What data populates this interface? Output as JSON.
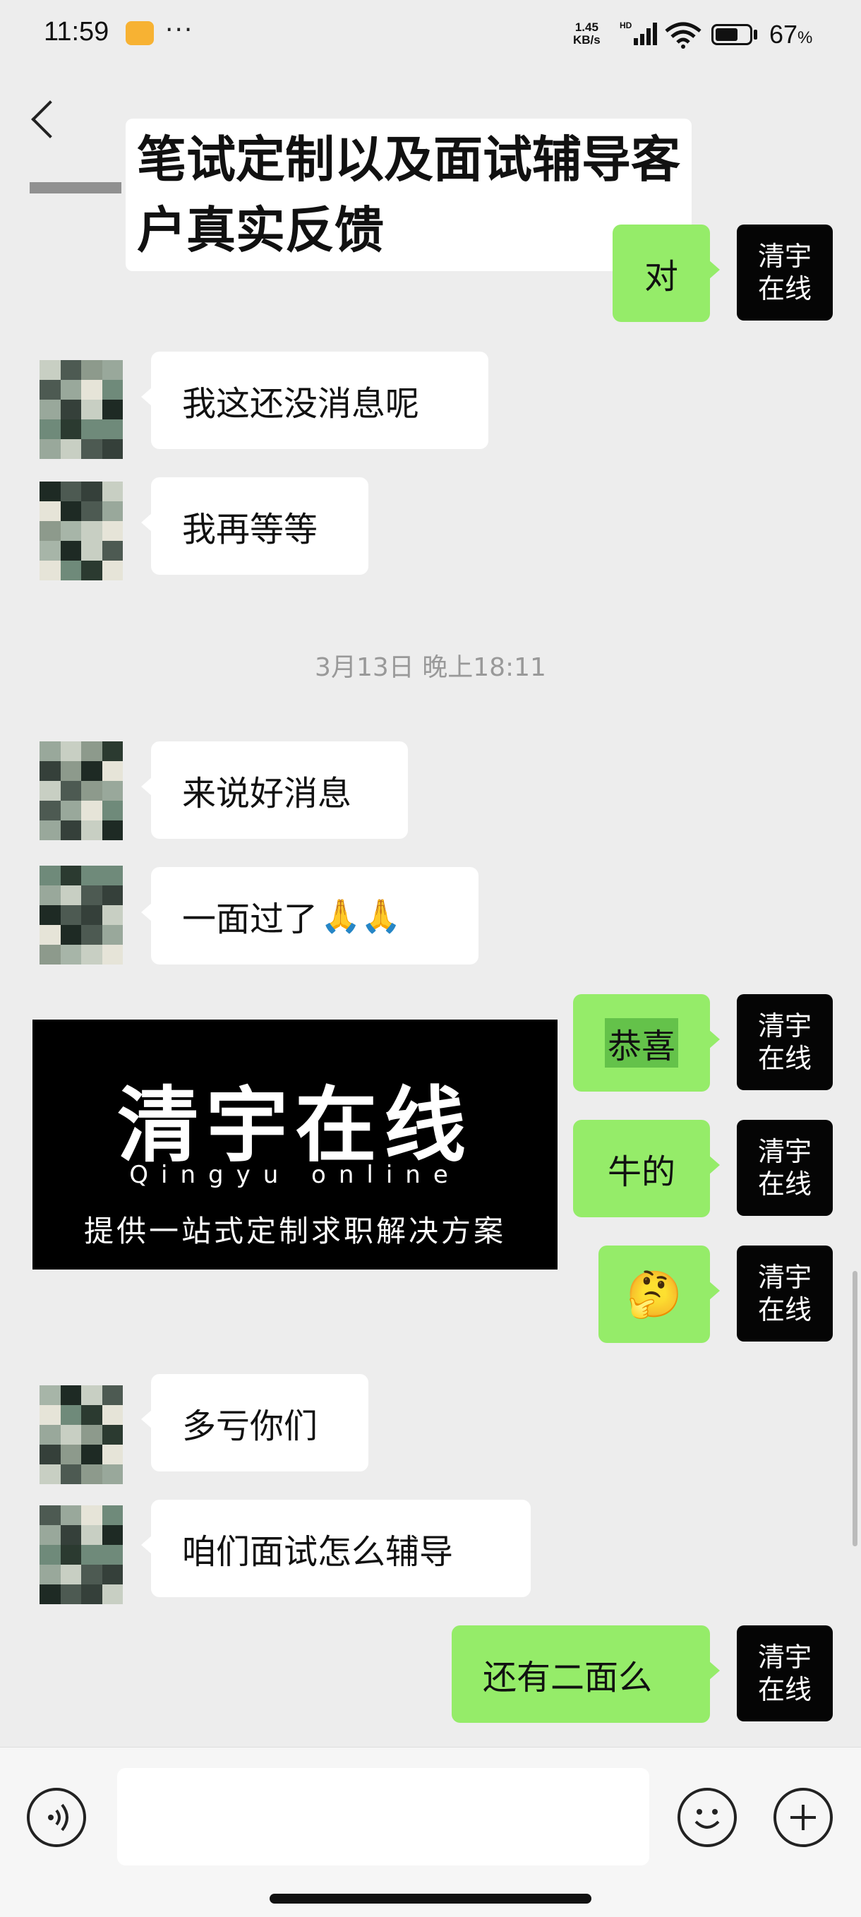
{
  "status_bar": {
    "time": "11:59",
    "dots": "···",
    "net_speed_value": "1.45",
    "net_speed_unit": "KB/s",
    "hd_label": "HD",
    "battery_percent": "67",
    "battery_level": 0.67
  },
  "header": {
    "title": "笔试定制以及面试辅导客\n户真实反馈"
  },
  "me_avatar": {
    "line1": "清宇",
    "line2": "在线"
  },
  "messages": {
    "m1": "对",
    "m2": "我这还没消息呢",
    "m3": "我再等等",
    "timestamp": "3月13日 晚上18:11",
    "m4": "来说好消息",
    "m5": "一面过了",
    "m6": "恭喜",
    "m7": "牛的",
    "m8_emoji": "🤔",
    "m9": "多亏你们",
    "m10": "咱们面试怎么辅导",
    "m11": "还有二面么"
  },
  "watermark": {
    "title": "清宇在线",
    "english": "Qingyu online",
    "desc": "提供一站式定制求职解决方案"
  },
  "colors": {
    "me_bubble": "#95ec69",
    "them_bubble": "#ffffff",
    "background": "#ededed"
  },
  "input": {
    "placeholder": ""
  }
}
